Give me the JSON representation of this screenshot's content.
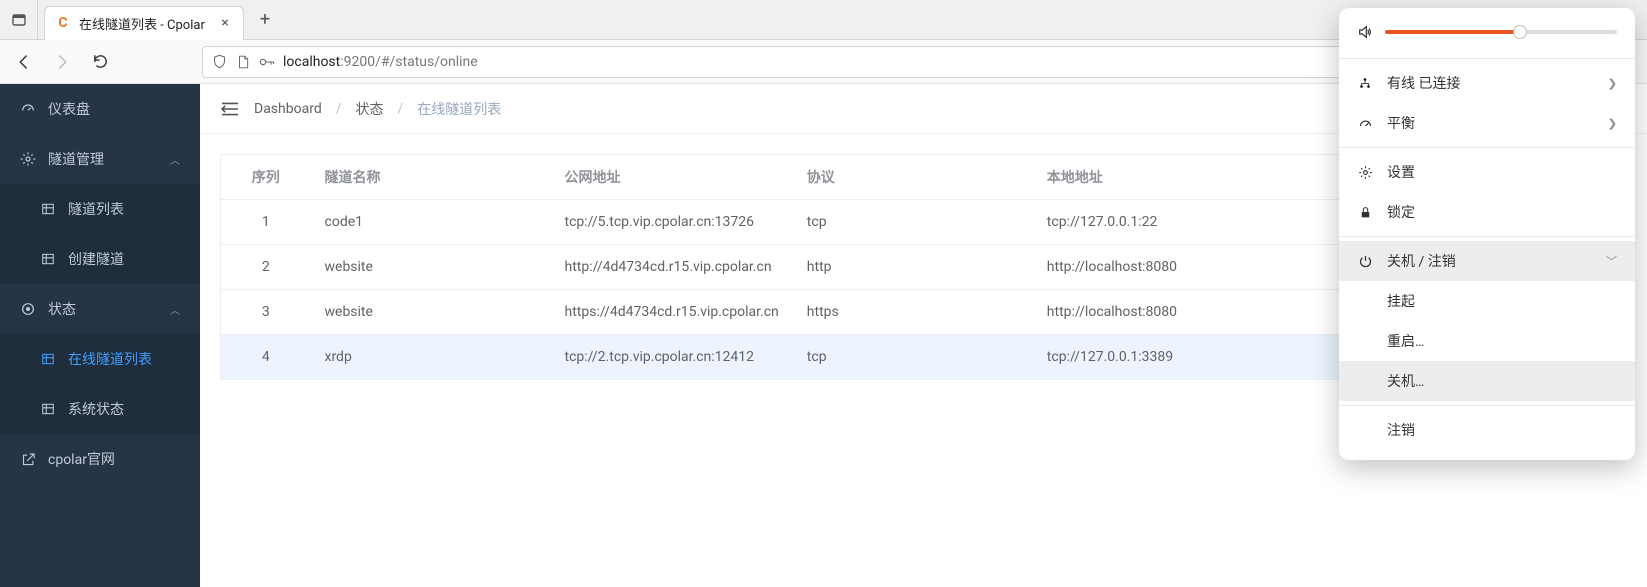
{
  "browser": {
    "tab_title": "在线隧道列表 - Cpolar",
    "favicon_letter": "C",
    "url_host": "localhost",
    "url_rest": ":9200/#/status/online"
  },
  "sidebar": {
    "dashboard": "仪表盘",
    "tunnel_mgmt": "隧道管理",
    "tunnel_list": "隧道列表",
    "create_tunnel": "创建隧道",
    "status": "状态",
    "online_list": "在线隧道列表",
    "system_status": "系统状态",
    "official_site": "cpolar官网"
  },
  "breadcrumbs": {
    "dashboard": "Dashboard",
    "status": "状态",
    "current": "在线隧道列表"
  },
  "table": {
    "headers": {
      "seq": "序列",
      "name": "隧道名称",
      "public": "公网地址",
      "proto": "协议",
      "local": "本地地址"
    },
    "rows": [
      {
        "seq": "1",
        "name": "code1",
        "public": "tcp://5.tcp.vip.cpolar.cn:13726",
        "proto": "tcp",
        "local": "tcp://127.0.0.1:22"
      },
      {
        "seq": "2",
        "name": "website",
        "public": "http://4d4734cd.r15.vip.cpolar.cn",
        "proto": "http",
        "local": "http://localhost:8080"
      },
      {
        "seq": "3",
        "name": "website",
        "public": "https://4d4734cd.r15.vip.cpolar.cn",
        "proto": "https",
        "local": "http://localhost:8080"
      },
      {
        "seq": "4",
        "name": "xrdp",
        "public": "tcp://2.tcp.vip.cpolar.cn:12412",
        "proto": "tcp",
        "local": "tcp://127.0.0.1:3389"
      }
    ]
  },
  "sysmenu": {
    "wired": "有线 已连接",
    "balance": "平衡",
    "settings": "设置",
    "lock": "锁定",
    "power": "关机 / 注销",
    "suspend": "挂起",
    "restart": "重启…",
    "shutdown": "关机…",
    "logout": "注销"
  }
}
